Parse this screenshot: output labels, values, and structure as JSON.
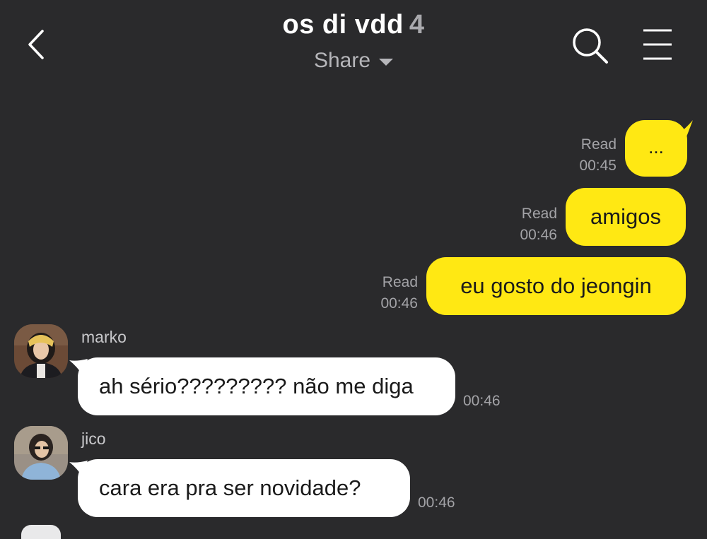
{
  "header": {
    "title": "os di vdd",
    "member_count": "4",
    "share_label": "Share",
    "icons": {
      "back": "back-chevron-icon",
      "share_dropdown": "caret-down-icon",
      "search": "search-icon",
      "menu": "hamburger-menu-icon"
    }
  },
  "colors": {
    "background": "#2a2a2c",
    "outgoing_bubble": "#ffe813",
    "incoming_bubble": "#ffffff",
    "meta_text": "#a3a3a7"
  },
  "messages": [
    {
      "direction": "out",
      "text": "...",
      "status": "Read",
      "time": "00:45"
    },
    {
      "direction": "out",
      "text": "amigos",
      "status": "Read",
      "time": "00:46"
    },
    {
      "direction": "out",
      "text": "eu gosto do jeongin",
      "status": "Read",
      "time": "00:46"
    },
    {
      "direction": "in",
      "sender": "marko",
      "text": "ah sério????????? não me diga",
      "time": "00:46"
    },
    {
      "direction": "in",
      "sender": "jico",
      "text": "cara era pra ser novidade?",
      "time": "00:46"
    }
  ]
}
